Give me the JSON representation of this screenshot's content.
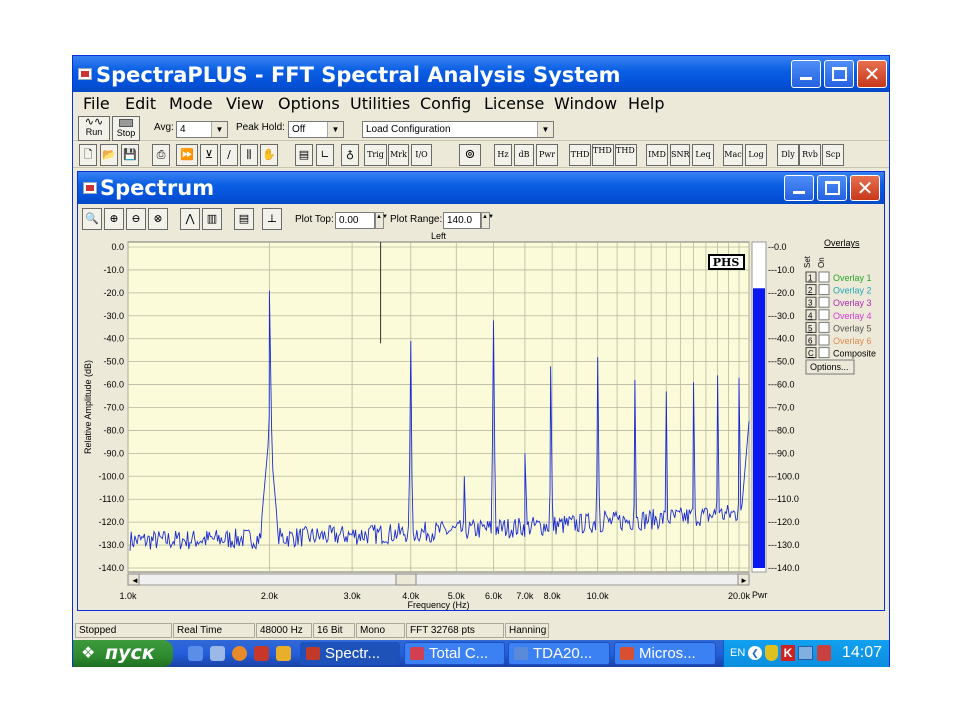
{
  "app": {
    "title": "SpectraPLUS - FFT Spectral Analysis System"
  },
  "menu": [
    "File",
    "Edit",
    "Mode",
    "View",
    "Options",
    "Utilities",
    "Config",
    "License",
    "Window",
    "Help"
  ],
  "toolbar1": {
    "run_label": "Run",
    "stop_label": "Stop",
    "avg_label": "Avg:",
    "avg_value": "4",
    "peak_hold_label": "Peak Hold:",
    "peak_hold_value": "Off",
    "load_config_value": "Load Configuration"
  },
  "toolbar2": [
    "Trig",
    "Mrk",
    "I/O",
    "Hz",
    "dB",
    "Pwr",
    "THD",
    "THD +N",
    "THD Freq",
    "IMD",
    "SNR",
    "Leq",
    "Mac",
    "Log",
    "Dly",
    "Rvb",
    "Scp"
  ],
  "spectrum": {
    "title": "Spectrum",
    "plot_top_label": "Plot Top:",
    "plot_top_value": "0.00",
    "plot_range_label": "Plot Range:",
    "plot_range_value": "140.0",
    "channel_label": "Left",
    "logo": "PHS",
    "power_bar": {
      "label": "Pwr",
      "level_db": -18
    },
    "overlays": {
      "header": "Overlays",
      "set_label": "Set",
      "on_label": "On",
      "items": [
        {
          "key": "1",
          "label": "Overlay 1",
          "color": "#2aa52a"
        },
        {
          "key": "2",
          "label": "Overlay 2",
          "color": "#23a8b8"
        },
        {
          "key": "3",
          "label": "Overlay 3",
          "color": "#b02ab0"
        },
        {
          "key": "4",
          "label": "Overlay 4",
          "color": "#d83ad8"
        },
        {
          "key": "5",
          "label": "Overlay 5",
          "color": "#555555"
        },
        {
          "key": "6",
          "label": "Overlay 6",
          "color": "#e08a50"
        },
        {
          "key": "C",
          "label": "Composite",
          "color": "#000000"
        }
      ],
      "options_label": "Options..."
    }
  },
  "chart_data": {
    "type": "line",
    "title": "",
    "xlabel": "Frequency (Hz)",
    "ylabel": "Relative Amplitude (dB)",
    "x_scale": "log",
    "xlim": [
      1000,
      21000
    ],
    "ylim": [
      -140,
      0
    ],
    "x_tick_labels": [
      "1.0k",
      "2.0k",
      "3.0k",
      "4.0k",
      "5.0k",
      "6.0k",
      "7.0k",
      "8.0k",
      "10.0k",
      "20.0k"
    ],
    "x_tick_values": [
      1000,
      2000,
      3000,
      4000,
      5000,
      6000,
      7000,
      8000,
      10000,
      20000
    ],
    "y_ticks": [
      0,
      -10,
      -20,
      -30,
      -40,
      -50,
      -60,
      -70,
      -80,
      -90,
      -100,
      -110,
      -120,
      -130,
      -140
    ],
    "y_tick_labels": [
      "0.0",
      "-10.0",
      "-20.0",
      "-30.0",
      "-40.0",
      "-50.0",
      "-60.0",
      "-70.0",
      "-80.0",
      "-90.0",
      "-100.0",
      "-110.0",
      "-120.0",
      "-130.0",
      "-140.0"
    ],
    "right_axis_tick_labels": [
      "0.0",
      "-10.0",
      "-20.0",
      "-30.0",
      "-40.0",
      "-50.0",
      "-60.0",
      "-70.0",
      "-80.0",
      "-90.0",
      "-100.0",
      "-110.0",
      "-120.0",
      "-130.0",
      "-140.0"
    ],
    "grid": true,
    "marker_line": {
      "freq": 3450,
      "level_db": -42
    },
    "noise_floor": {
      "start_db": -128,
      "end_db": -116
    },
    "peaks": [
      {
        "freq": 2000,
        "db": -19
      },
      {
        "freq": 4000,
        "db": -41
      },
      {
        "freq": 5200,
        "db": -100
      },
      {
        "freq": 6000,
        "db": -32
      },
      {
        "freq": 7000,
        "db": -90
      },
      {
        "freq": 7940,
        "db": -52
      },
      {
        "freq": 10000,
        "db": -48
      },
      {
        "freq": 10350,
        "db": -115
      },
      {
        "freq": 12000,
        "db": -58
      },
      {
        "freq": 14000,
        "db": -63
      },
      {
        "freq": 16000,
        "db": -59
      },
      {
        "freq": 18000,
        "db": -56
      },
      {
        "freq": 20000,
        "db": -57
      },
      {
        "freq": 21000,
        "db": -76
      }
    ],
    "series": [
      {
        "values": []
      }
    ]
  },
  "status": [
    "Stopped",
    "Real Time",
    "48000 Hz",
    "16 Bit",
    "Mono",
    "FFT 32768 pts",
    "Hanning"
  ],
  "taskbar": {
    "start_label": "пуск",
    "tasks": [
      {
        "label": "Spectr...",
        "color": "#c0392b"
      },
      {
        "label": "Total C...",
        "color": "#d04050"
      },
      {
        "label": "TDA20...",
        "color": "#5b8bd8"
      },
      {
        "label": "Micros...",
        "color": "#d85030"
      }
    ],
    "lang": "EN",
    "clock": "14:07"
  },
  "colors": {
    "plot_bg": "#fbfbd9",
    "trace": "#1c2cd2",
    "power_bar": "#0a17f0",
    "title_bar": "#0a5fe3"
  }
}
